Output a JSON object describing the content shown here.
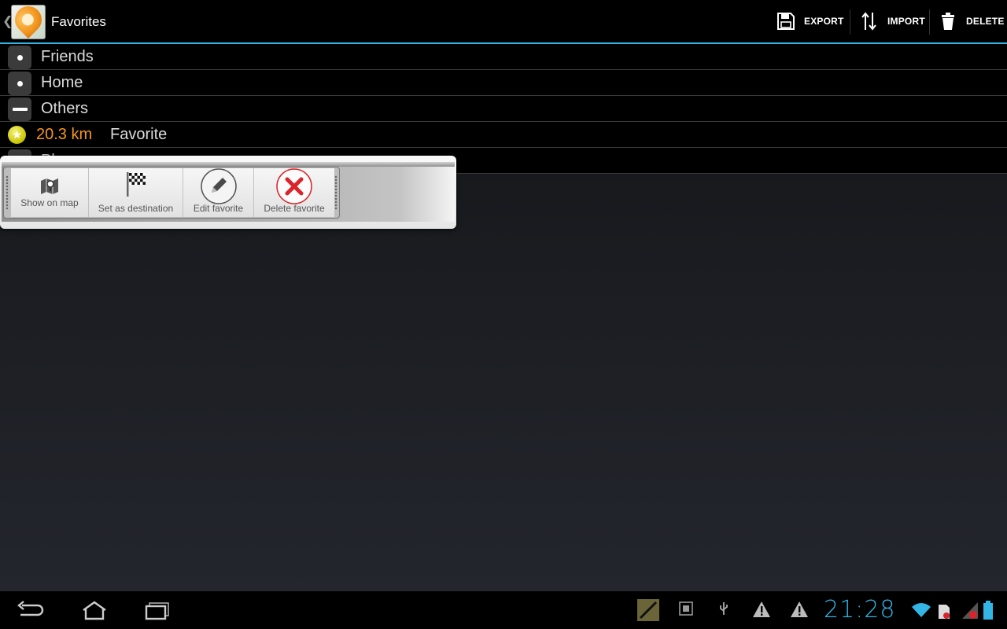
{
  "actionbar": {
    "title": "Favorites",
    "actions": [
      {
        "label": "EXPORT",
        "icon": "save-icon"
      },
      {
        "label": "IMPORT",
        "icon": "import-arrows-icon"
      },
      {
        "label": "DELETE",
        "icon": "trash-icon"
      }
    ]
  },
  "list": {
    "groups": [
      {
        "label": "Friends",
        "state": "collapsed"
      },
      {
        "label": "Home",
        "state": "collapsed"
      },
      {
        "label": "Others",
        "state": "expanded"
      }
    ],
    "favorite": {
      "distance": "20.3 km",
      "label": "Favorite"
    },
    "partial_label": "Pl"
  },
  "quick_actions": [
    {
      "label": "Show on map",
      "icon": "map-pin-icon"
    },
    {
      "label": "Set as destination",
      "icon": "checkered-flag-icon"
    },
    {
      "label": "Edit favorite",
      "icon": "pencil-icon"
    },
    {
      "label": "Delete favorite",
      "icon": "red-x-icon"
    }
  ],
  "sysbar": {
    "clock": "21:28",
    "nav": [
      "back-icon",
      "home-icon",
      "recent-apps-icon"
    ],
    "tray": [
      "notes-app-icon",
      "android-debug-icon",
      "usb-icon",
      "warning-icon",
      "warning-icon",
      "wifi-icon",
      "sd-card-icon",
      "signal-icon",
      "battery-icon"
    ]
  },
  "colors": {
    "accent": "#33b5e5",
    "distance": "#f7941d",
    "delete_red": "#d8242a"
  }
}
